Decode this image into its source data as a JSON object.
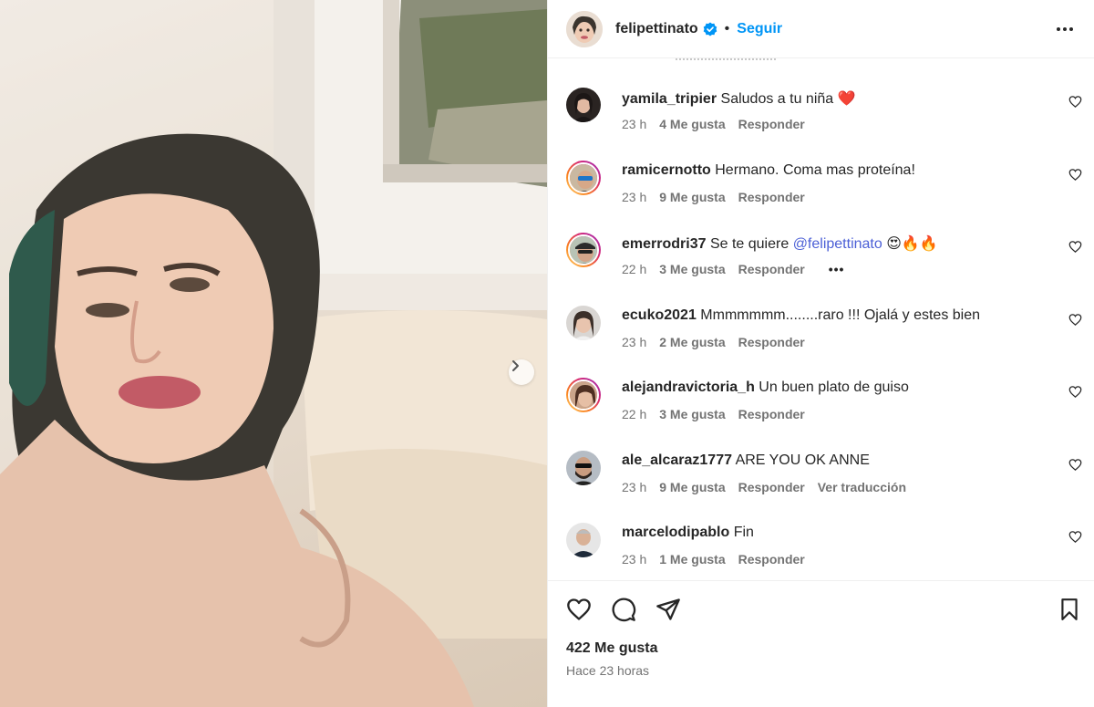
{
  "post": {
    "username": "felipettinato",
    "follow_label": "Seguir",
    "dot": "•",
    "likes_text": "422 Me gusta",
    "time_ago": "Hace 23 horas"
  },
  "icons": {
    "verified": "verified-badge-icon",
    "more": "more-options-icon",
    "like": "heart-icon",
    "comment": "comment-icon",
    "share": "share-icon",
    "save": "bookmark-icon",
    "carousel_next": "chevron-right-icon"
  },
  "colors": {
    "accent": "#0095f6",
    "mention": "#4b5fd6",
    "muted": "#737373",
    "text": "#262626"
  },
  "comments": [
    {
      "user": "yamila_tripier",
      "text": "Saludos a tu niña",
      "emoji": "❤️",
      "time": "23 h",
      "likes": "4 Me gusta",
      "reply": "Responder"
    },
    {
      "user": "ramicernotto",
      "text": "Hermano. Coma mas proteína!",
      "time": "23 h",
      "likes": "9 Me gusta",
      "reply": "Responder"
    },
    {
      "user": "emerrodri37",
      "text": "Se te quiere",
      "mention": "@felipettinato",
      "emoji": "😍🔥🔥",
      "time": "22 h",
      "likes": "3 Me gusta",
      "reply": "Responder",
      "dots": "•••"
    },
    {
      "user": "ecuko2021",
      "text": "Mmmmmmm........raro !!! Ojalá y estes bien",
      "time": "23 h",
      "likes": "2 Me gusta",
      "reply": "Responder"
    },
    {
      "user": "alejandravictoria_h",
      "text": "Un buen plato de guiso",
      "time": "22 h",
      "likes": "3 Me gusta",
      "reply": "Responder"
    },
    {
      "user": "ale_alcaraz1777",
      "text": "ARE YOU OK ANNE",
      "time": "23 h",
      "likes": "9 Me gusta",
      "reply": "Responder",
      "translate": "Ver traducción"
    },
    {
      "user": "marcelodipablo",
      "text": "Fin",
      "time": "23 h",
      "likes": "1 Me gusta",
      "reply": "Responder"
    }
  ]
}
